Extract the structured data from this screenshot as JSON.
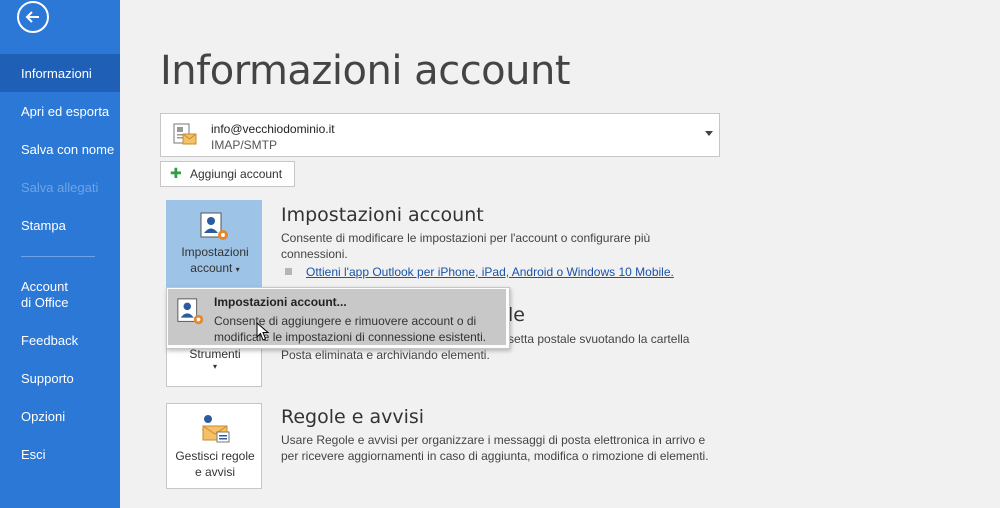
{
  "sidebar": {
    "items": [
      {
        "label": "Informazioni",
        "active": true
      },
      {
        "label": "Apri ed esporta"
      },
      {
        "label": "Salva con nome"
      },
      {
        "label": "Salva allegati",
        "disabled": true
      },
      {
        "label": "Stampa"
      },
      {
        "label": "Account\ndi Office"
      },
      {
        "label": "Feedback"
      },
      {
        "label": "Supporto"
      },
      {
        "label": "Opzioni"
      },
      {
        "label": "Esci"
      }
    ]
  },
  "page_title": "Informazioni account",
  "account": {
    "email": "info@vecchiodominio.it",
    "type": "IMAP/SMTP"
  },
  "add_account_label": "Aggiungi account",
  "settings": {
    "button_label_line1": "Impostazioni",
    "button_label_line2": "account",
    "title": "Impostazioni account",
    "description": "Consente di modificare le impostazioni per l'account o configurare più connessioni.",
    "link": "Ottieni l'app Outlook per iPhone, iPad, Android o Windows 10 Mobile."
  },
  "tools": {
    "button_label": "Strumenti",
    "title_visible_part": "le",
    "description_line1": "setta postale svuotando la cartella",
    "description_line2": "Posta eliminata e archiviando elementi."
  },
  "rules": {
    "button_label_line1": "Gestisci regole",
    "button_label_line2": "e avvisi",
    "title": "Regole e avvisi",
    "description": "Usare Regole e avvisi per organizzare i messaggi di posta elettronica in arrivo e per ricevere aggiornamenti in caso di aggiunta, modifica o rimozione di elementi."
  },
  "dropdown": {
    "item_title": "Impostazioni account...",
    "item_description": "Consente di aggiungere e rimuovere account o di modificare le impostazioni di connessione esistenti."
  },
  "colors": {
    "sidebar": "#2b78d6",
    "sidebar_active": "#1f5fb5",
    "active_button": "#9dc3e6",
    "link": "#1a52a8"
  }
}
